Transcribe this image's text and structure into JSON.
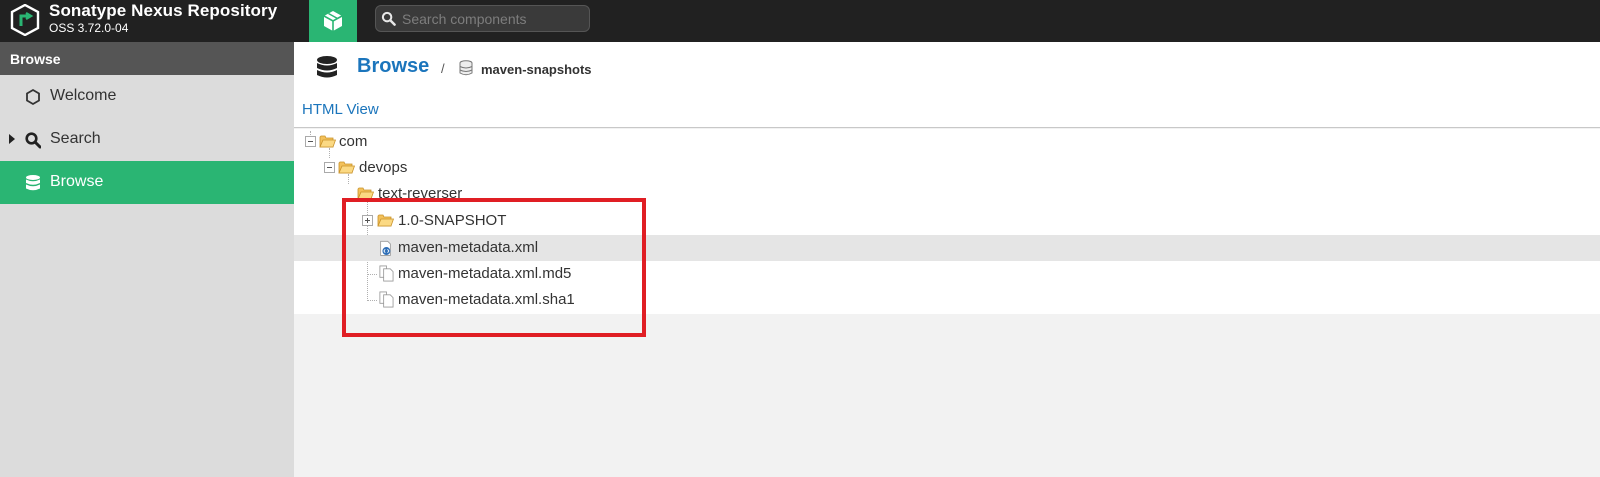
{
  "header": {
    "brand_name": "Sonatype Nexus Repository",
    "brand_version": "OSS 3.72.0-04",
    "mode_icon": "cube-icon",
    "search_placeholder": "Search components"
  },
  "sidebar": {
    "title": "Browse",
    "items": [
      {
        "label": "Welcome",
        "icon": "hexagon-icon",
        "active": false
      },
      {
        "label": "Search",
        "icon": "search-icon",
        "active": false,
        "expandable": true
      },
      {
        "label": "Browse",
        "icon": "database-icon",
        "active": true
      }
    ]
  },
  "breadcrumb": {
    "title": "Browse",
    "separator": "/",
    "repository": "maven-snapshots"
  },
  "links": {
    "html_view": "HTML View"
  },
  "tree": {
    "nodes": [
      {
        "label": "com",
        "type": "folder",
        "expanded": true
      },
      {
        "label": "devops",
        "type": "folder",
        "expanded": true
      },
      {
        "label": "text-reverser",
        "type": "folder",
        "expanded": true
      },
      {
        "label": "1.0-SNAPSHOT",
        "type": "folder",
        "expanded": false
      },
      {
        "label": "maven-metadata.xml",
        "type": "xml-file",
        "selected": true
      },
      {
        "label": "maven-metadata.xml.md5",
        "type": "file"
      },
      {
        "label": "maven-metadata.xml.sha1",
        "type": "file"
      }
    ]
  },
  "colors": {
    "accent": "#2ab573",
    "link": "#1b75bc",
    "header_bg": "#212121",
    "highlight": "#e01e24"
  }
}
